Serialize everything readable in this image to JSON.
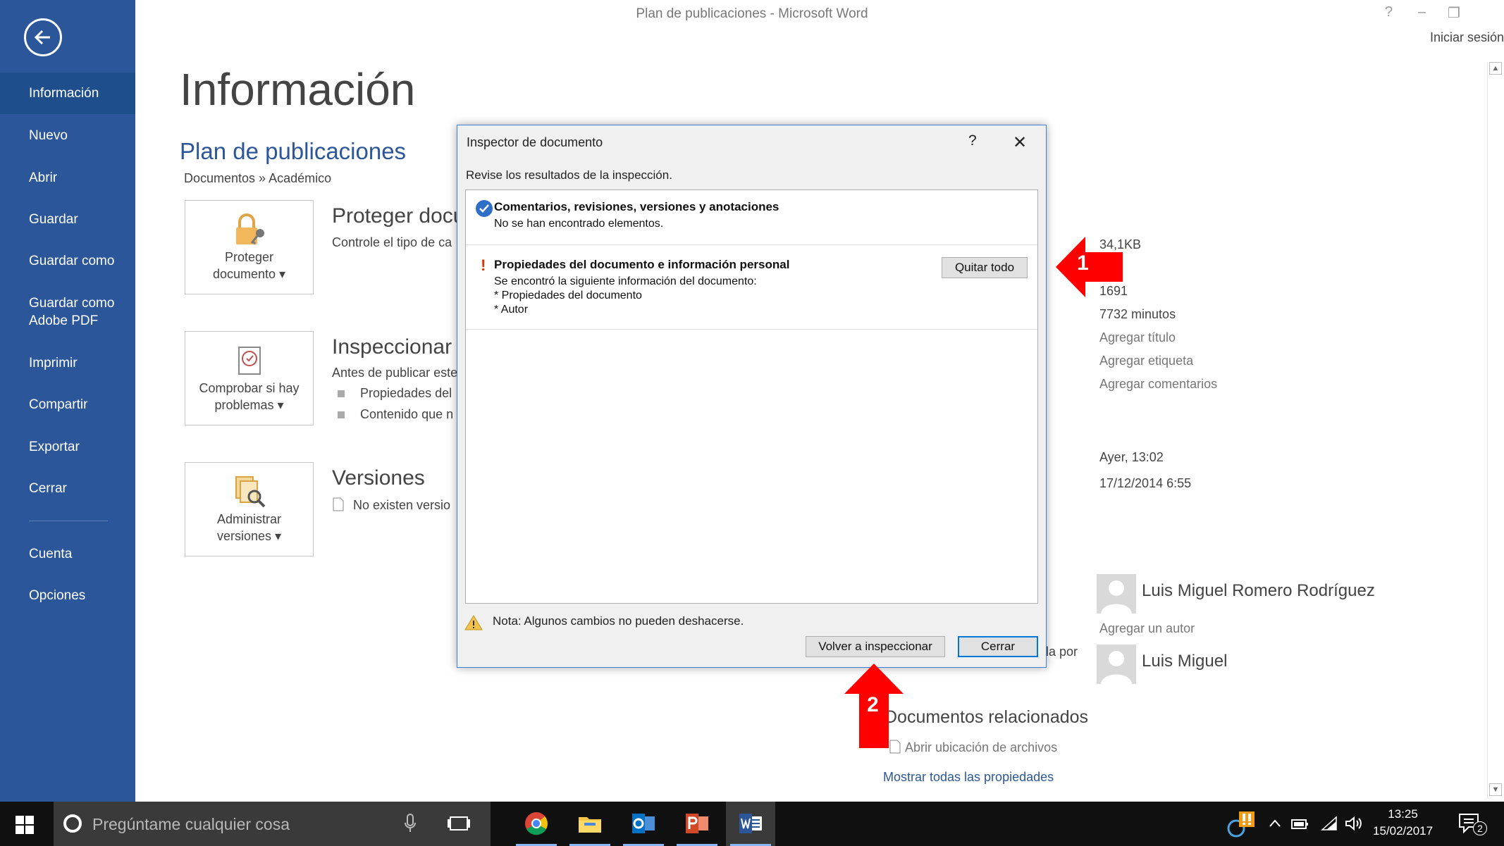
{
  "window": {
    "title": "Plan de publicaciones - Microsoft Word",
    "help": "?",
    "minimize": "–",
    "restore": "❐",
    "signin": "Iniciar sesión"
  },
  "sidebar": {
    "items": [
      {
        "label": "Información"
      },
      {
        "label": "Nuevo"
      },
      {
        "label": "Abrir"
      },
      {
        "label": "Guardar"
      },
      {
        "label": "Guardar como"
      },
      {
        "label_line1": "Guardar como",
        "label_line2": "Adobe PDF"
      },
      {
        "label": "Imprimir"
      },
      {
        "label": "Compartir"
      },
      {
        "label": "Exportar"
      },
      {
        "label": "Cerrar"
      },
      {
        "label": "Cuenta"
      },
      {
        "label": "Opciones"
      }
    ],
    "accent": "#2b579a"
  },
  "main": {
    "page_title": "Información",
    "doc_title": "Plan de publicaciones",
    "breadcrumb": "Documentos » Académico",
    "protect": {
      "button_line1": "Proteger",
      "button_line2": "documento ▾",
      "title": "Proteger docu",
      "text": "Controle el tipo de ca"
    },
    "inspect": {
      "button_line1": "Comprobar si hay",
      "button_line2": "problemas ▾",
      "title": "Inspeccionar d",
      "text": "Antes de publicar este",
      "bullet1": "Propiedades del",
      "bullet2": "Contenido que n"
    },
    "versions": {
      "button_line1": "Administrar",
      "button_line2": "versiones ▾",
      "title": "Versiones",
      "text": "No existen versio"
    }
  },
  "properties": {
    "size": "34,1KB",
    "pages": "1691",
    "edit_time": "7732 minutos",
    "add_title": "Agregar título",
    "add_tag": "Agregar etiqueta",
    "add_comments": "Agregar comentarios",
    "modified": "Ayer, 13:02",
    "created": "17/12/2014 6:55",
    "author": "Luis Miguel Romero Rodríguez",
    "add_author": "Agregar un autor",
    "modified_by_label": "la por",
    "modified_by": "Luis Miguel",
    "related_title": "Documentos relacionados",
    "open_location": "Abrir ubicación de archivos",
    "show_all": "Mostrar todas las propiedades"
  },
  "dialog": {
    "title": "Inspector de documento",
    "help": "?",
    "close": "✕",
    "subtitle": "Revise los resultados de la inspección.",
    "result1": {
      "heading": "Comentarios, revisiones, versiones y anotaciones",
      "line1": "No se han encontrado elementos."
    },
    "result2": {
      "heading": "Propiedades del documento e información personal",
      "line1": "Se encontró la siguiente información del documento:",
      "line2": "* Propiedades del documento",
      "line3": "* Autor",
      "remove_all": "Quitar todo",
      "mark": "!"
    },
    "note": "Nota: Algunos cambios no pueden deshacerse.",
    "reinspect": "Volver a inspeccionar",
    "close_button": "Cerrar"
  },
  "annotations": {
    "arrow1": "1",
    "arrow2": "2",
    "color": "#ff0000"
  },
  "taskbar": {
    "search_placeholder": "Pregúntame cualquier cosa",
    "time": "13:25",
    "date": "15/02/2017",
    "notifications": "2",
    "apps": [
      "task-view-icon",
      "chrome-icon",
      "file-explorer-icon",
      "outlook-icon",
      "powerpoint-icon",
      "word-icon"
    ]
  }
}
